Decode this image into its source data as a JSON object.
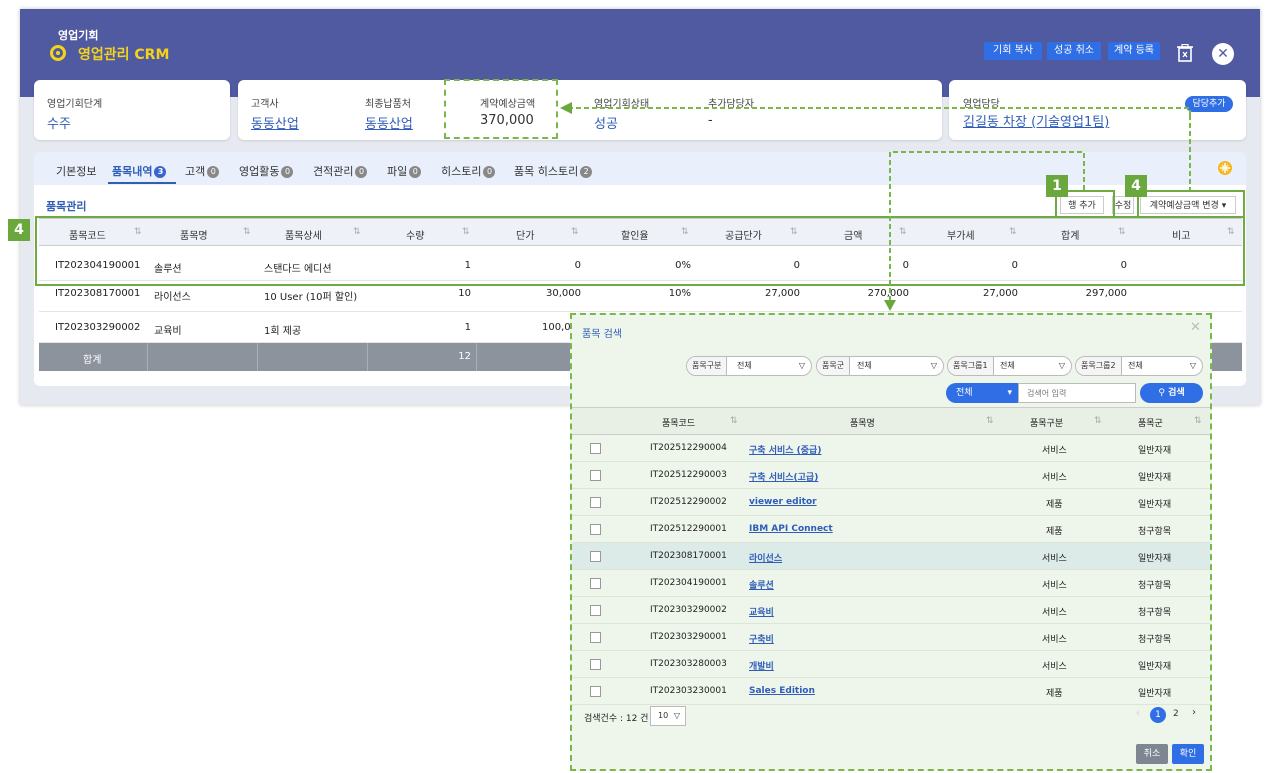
{
  "header": {
    "subtitle": "영업기회",
    "title": "영업관리 CRM",
    "buttons": [
      "기회 복사",
      "성공 취소",
      "계약 등록"
    ],
    "close_icon": "✕"
  },
  "cards": {
    "stage": {
      "label": "영업기회단계",
      "value": "수주"
    },
    "customer": {
      "label": "고객사",
      "value": "동동산업"
    },
    "delivery": {
      "label": "최종납품처",
      "value": "동동산업"
    },
    "amount": {
      "label": "계약예상금액",
      "value": "370,000"
    },
    "status": {
      "label": "영업기회상태",
      "value": "성공"
    },
    "extra": {
      "label": "추가담당자",
      "value": "-"
    },
    "owner": {
      "label": "영업담당",
      "value": "김길동 차장 (기술영업1팀)",
      "button": "담당추가"
    }
  },
  "tabs": [
    {
      "label": "기본정보",
      "count": ""
    },
    {
      "label": "품목내역",
      "count": "3"
    },
    {
      "label": "고객",
      "count": "0"
    },
    {
      "label": "영업활동",
      "count": "0"
    },
    {
      "label": "견적관리",
      "count": "0"
    },
    {
      "label": "파일",
      "count": "0"
    },
    {
      "label": "히스토리",
      "count": "0"
    },
    {
      "label": "품목 히스토리",
      "count": "2"
    }
  ],
  "items": {
    "section_title": "품목관리",
    "add_row": "행 추가",
    "edit": "수정",
    "amount_change": "계약예상금액 변경",
    "columns": [
      "품목코드",
      "품목명",
      "품목상세",
      "수량",
      "단가",
      "할인율",
      "공급단가",
      "금액",
      "부가세",
      "합계",
      "비고"
    ],
    "rows": [
      [
        "IT202304190001",
        "솔루션",
        "스탠다드 에디션",
        "1",
        "0",
        "0%",
        "0",
        "0",
        "0",
        "0",
        ""
      ],
      [
        "IT202308170001",
        "라이선스",
        "10 User (10퍼 할인)",
        "10",
        "30,000",
        "10%",
        "27,000",
        "270,000",
        "27,000",
        "297,000",
        ""
      ],
      [
        "IT202303290002",
        "교육비",
        "1회 제공",
        "1",
        "100,0",
        "",
        "",
        "",
        "",
        "",
        ""
      ]
    ],
    "total_label": "합계",
    "total_qty": "12"
  },
  "markers": {
    "one": "1",
    "four_a": "4",
    "four_b": "4"
  },
  "modal": {
    "title": "품목 검색",
    "filters": [
      {
        "label": "품목구분",
        "value": "전체"
      },
      {
        "label": "품목군",
        "value": "전체"
      },
      {
        "label": "품목그룹1",
        "value": "전체"
      },
      {
        "label": "품목그룹2",
        "value": "전체"
      }
    ],
    "search_scope": "전체",
    "search_placeholder": "검색어 입력",
    "search_button": "검색",
    "columns": [
      "품목코드",
      "품목명",
      "품목구분",
      "품목군"
    ],
    "rows": [
      [
        "IT202512290004",
        "구축 서비스 (중급)",
        "서비스",
        "일반자재"
      ],
      [
        "IT202512290003",
        "구축 서비스(고급)",
        "서비스",
        "일반자재"
      ],
      [
        "IT202512290002",
        "viewer editor",
        "제품",
        "일반자재"
      ],
      [
        "IT202512290001",
        "IBM API Connect",
        "제품",
        "청구항목"
      ],
      [
        "IT202308170001",
        "라이선스",
        "서비스",
        "일반자재"
      ],
      [
        "IT202304190001",
        "솔루션",
        "서비스",
        "청구항목"
      ],
      [
        "IT202303290002",
        "교육비",
        "서비스",
        "청구항목"
      ],
      [
        "IT202303290001",
        "구축비",
        "서비스",
        "청구항목"
      ],
      [
        "IT202303280003",
        "개발비",
        "서비스",
        "일반자재"
      ],
      [
        "IT202303230001",
        "Sales Edition",
        "제품",
        "일반자재"
      ]
    ],
    "count_text": "검색건수 : 12 건",
    "page_size": "10",
    "pages": [
      "1",
      "2"
    ],
    "cancel": "취소",
    "confirm": "확인"
  }
}
